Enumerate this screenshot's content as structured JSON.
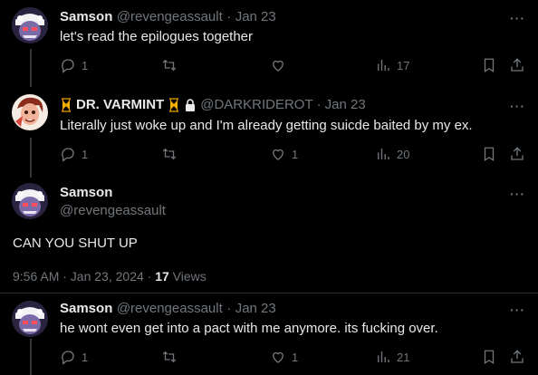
{
  "tweets": [
    {
      "display_name": "Samson",
      "handle": "@revengeassault",
      "date": "Jan 23",
      "text": "let's read the epilogues together",
      "replies": "1",
      "reposts": "",
      "likes": "",
      "views": "17"
    },
    {
      "display_name": "DR. VARMINT",
      "handle": "@DARKRIDEROT",
      "date": "Jan 23",
      "text": "Literally just woke up and I'm already getting suicde baited by my ex.",
      "replies": "1",
      "reposts": "",
      "likes": "1",
      "views": "20"
    }
  ],
  "main_tweet": {
    "display_name": "Samson",
    "handle": "@revengeassault",
    "text": "CAN YOU SHUT UP",
    "timestamp": "9:56 AM · Jan 23, 2024 · ",
    "views_count": "17",
    "views_label": " Views"
  },
  "reply": {
    "display_name": "Samson",
    "handle": "@revengeassault",
    "date": "Jan 23",
    "text": "he wont even get into a pact with me anymore. its fucking over.",
    "replies": "1",
    "reposts": "",
    "likes": "1",
    "views": "21"
  },
  "common": {
    "dot_sep": "·",
    "more": "···"
  },
  "colors": {
    "background": "#000000",
    "text": "#e7e9ea",
    "muted": "#71767b",
    "divider": "#2f3336",
    "hourglass": "#f4b400"
  },
  "icons": [
    "reply-icon",
    "repost-icon",
    "like-icon",
    "views-icon",
    "bookmark-icon",
    "share-icon",
    "more-icon",
    "hourglass-icon",
    "lock-icon"
  ]
}
